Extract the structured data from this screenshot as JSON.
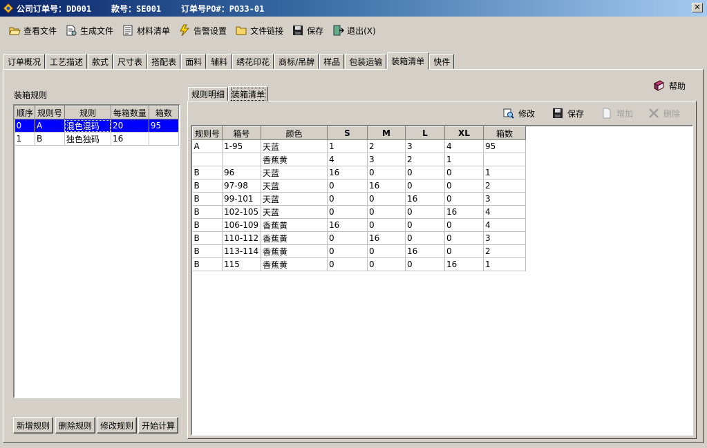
{
  "window": {
    "title": "公司订单号：DD001    款号：SE001    订单号PO#：PO33-01",
    "close_glyph": "✕"
  },
  "toolbar": {
    "view_file": "查看文件",
    "gen_file": "生成文件",
    "material_list": "材料清单",
    "alert_settings": "告警设置",
    "file_link": "文件链接",
    "save": "保存",
    "exit": "退出(X)"
  },
  "tabs": [
    "订单概况",
    "工艺描述",
    "款式",
    "尺寸表",
    "搭配表",
    "面料",
    "辅料",
    "绣花印花",
    "商标/吊牌",
    "样品",
    "包装运输",
    "装箱清单",
    "快件"
  ],
  "active_tab": "装箱清单",
  "left": {
    "title": "装箱规则",
    "columns": [
      "顺序",
      "规则号",
      "规则",
      "每箱数量",
      "箱数"
    ],
    "rows": [
      [
        "0",
        "A",
        "混色混码",
        "20",
        "95"
      ],
      [
        "1",
        "B",
        "独色独码",
        "16",
        ""
      ]
    ],
    "buttons": {
      "add": "新增规则",
      "delete": "删除规则",
      "edit": "修改规则",
      "calc": "开始计算"
    }
  },
  "help_label": "帮助",
  "subtabs": [
    "规则明细",
    "装箱清单"
  ],
  "active_subtab": "装箱清单",
  "sub_toolbar": {
    "edit": "修改",
    "save": "保存",
    "add": "增加",
    "delete": "删除"
  },
  "packing": {
    "columns": [
      "规则号",
      "箱号",
      "颜色",
      "S",
      "M",
      "L",
      "XL",
      "箱数"
    ],
    "rows": [
      [
        "A",
        "1-95",
        "天蓝",
        "1",
        "2",
        "3",
        "4",
        "95"
      ],
      [
        "",
        "",
        "香蕉黄",
        "4",
        "3",
        "2",
        "1",
        ""
      ],
      [
        "B",
        "96",
        "天蓝",
        "16",
        "0",
        "0",
        "0",
        "1"
      ],
      [
        "B",
        "97-98",
        "天蓝",
        "0",
        "16",
        "0",
        "0",
        "2"
      ],
      [
        "B",
        "99-101",
        "天蓝",
        "0",
        "0",
        "16",
        "0",
        "3"
      ],
      [
        "B",
        "102-105",
        "天蓝",
        "0",
        "0",
        "0",
        "16",
        "4"
      ],
      [
        "B",
        "106-109",
        "香蕉黄",
        "16",
        "0",
        "0",
        "0",
        "4"
      ],
      [
        "B",
        "110-112",
        "香蕉黄",
        "0",
        "16",
        "0",
        "0",
        "3"
      ],
      [
        "B",
        "113-114",
        "香蕉黄",
        "0",
        "0",
        "16",
        "0",
        "2"
      ],
      [
        "B",
        "115",
        "香蕉黄",
        "0",
        "0",
        "0",
        "16",
        "1"
      ]
    ]
  },
  "colors": {
    "selection": "#0000ff",
    "titlebar_start": "#0a246a",
    "titlebar_end": "#a6caf0",
    "face": "#d4d0c8"
  }
}
